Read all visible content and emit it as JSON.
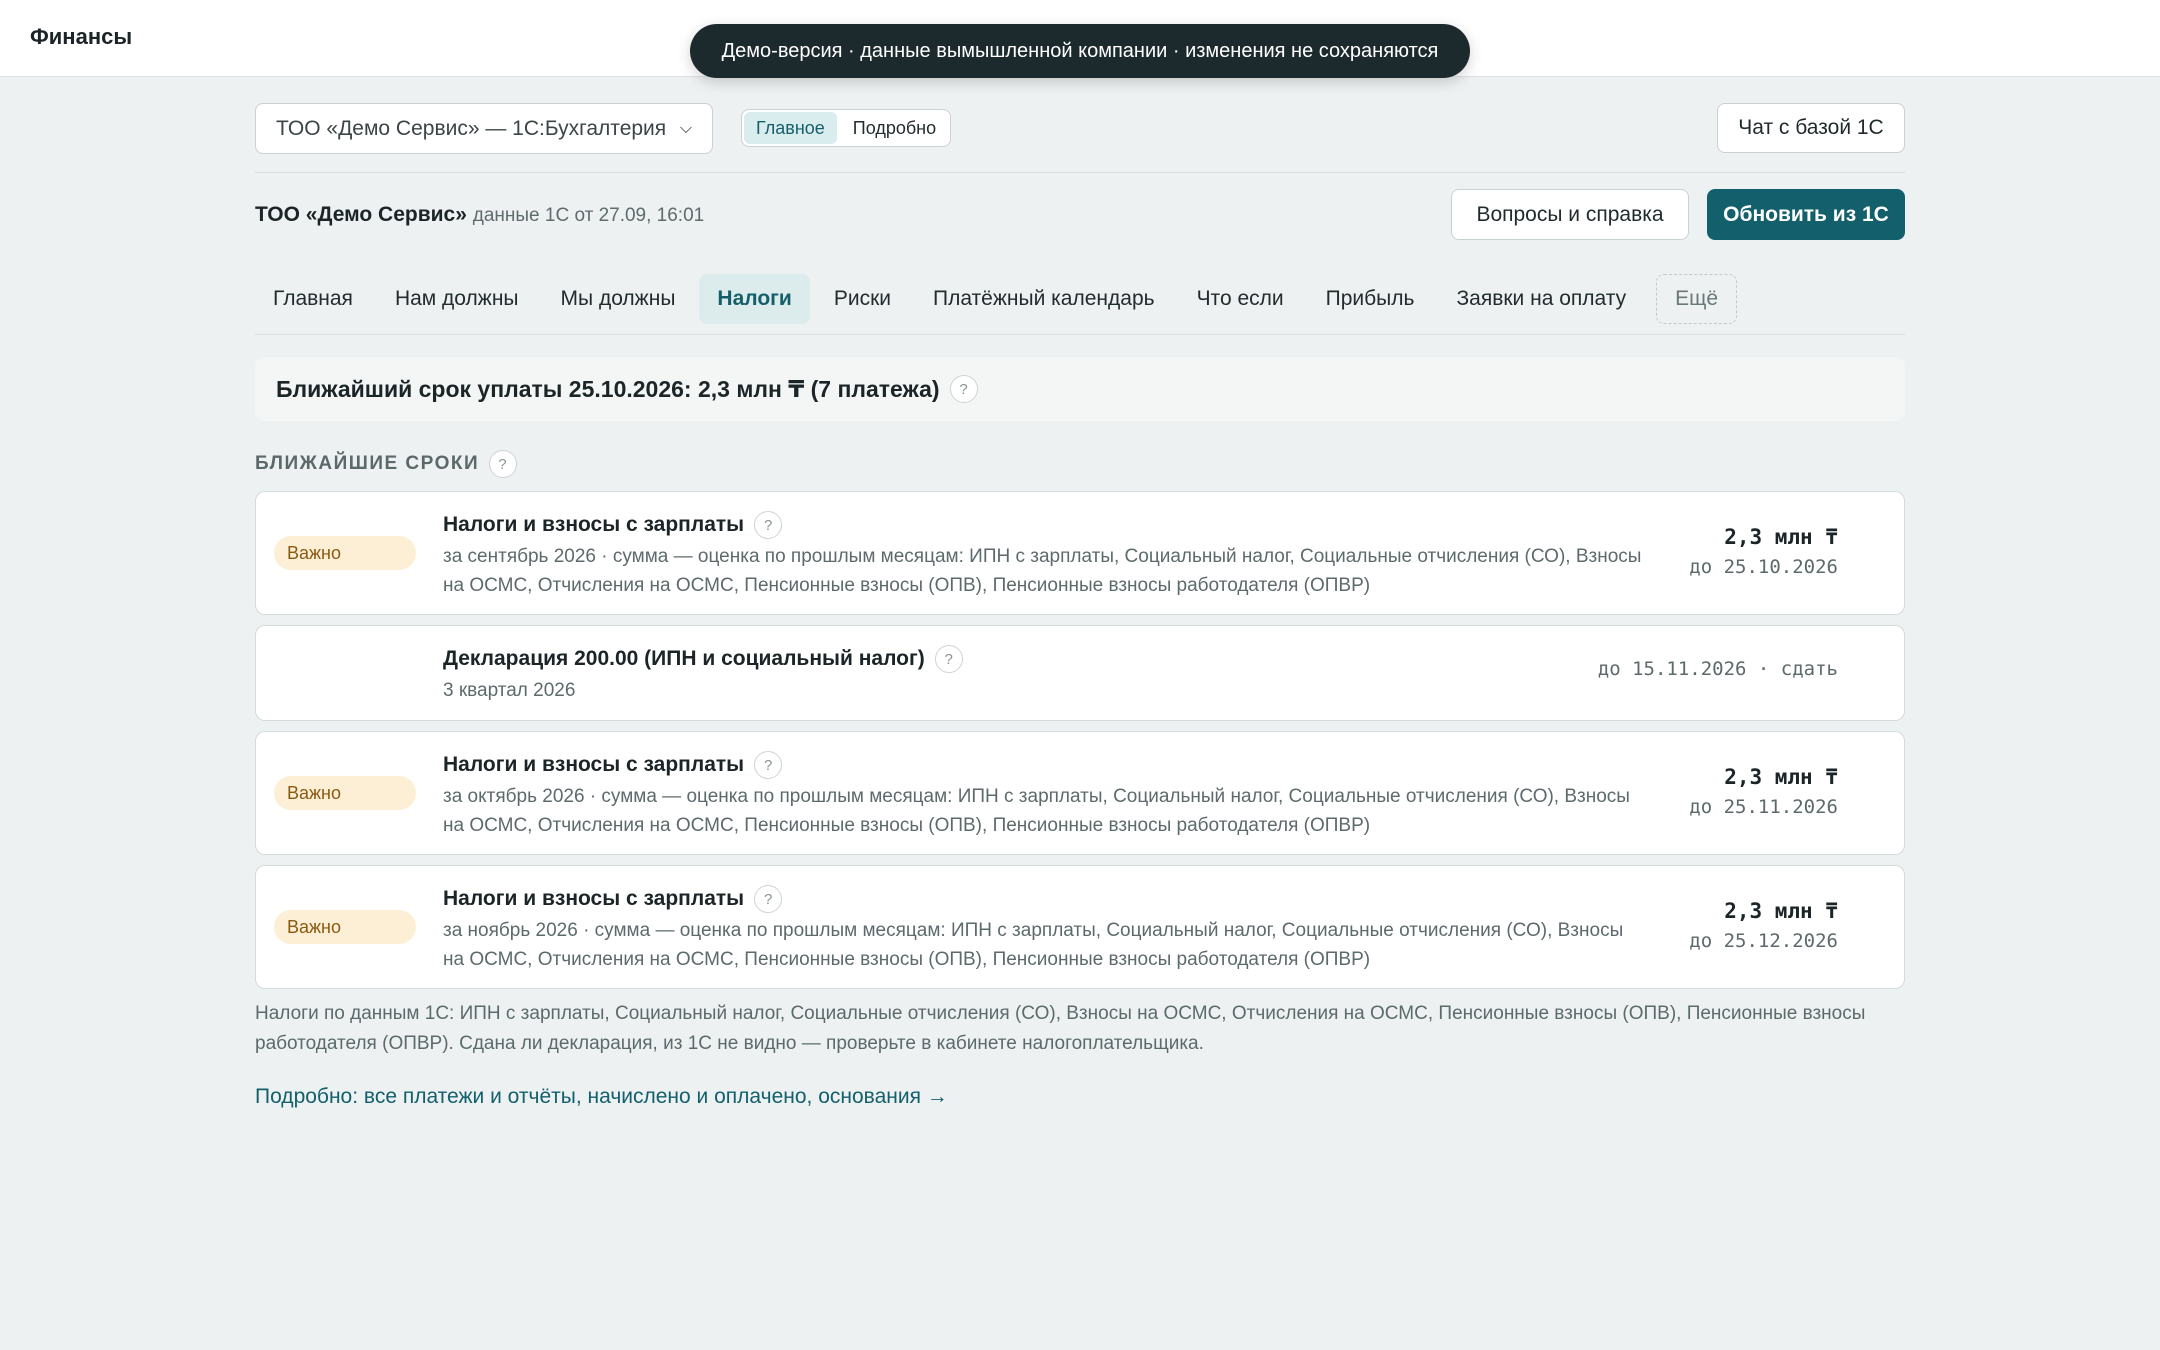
{
  "app": {
    "brand": "Финансы"
  },
  "banner": {
    "text": "Демо-версия · данные вымышленной компании · изменения не сохраняются"
  },
  "header": {
    "company_select": "ТОО «Демо Сервис» — 1С:Бухгалтерия",
    "view_modes": [
      "Главное",
      "Подробно"
    ],
    "active_view": "Главное",
    "chat_button": "Чат с базой 1С",
    "company_name": "ТОО «Демо Сервис»",
    "data_meta": "данные 1С от 27.09, 16:01",
    "help_button": "Вопросы и справка",
    "refresh_button": "Обновить из 1С"
  },
  "tabs": [
    {
      "label": "Главная",
      "active": false
    },
    {
      "label": "Нам должны",
      "active": false
    },
    {
      "label": "Мы должны",
      "active": false
    },
    {
      "label": "Налоги",
      "active": true
    },
    {
      "label": "Риски",
      "active": false
    },
    {
      "label": "Платёжный календарь",
      "active": false
    },
    {
      "label": "Что если",
      "active": false
    },
    {
      "label": "Прибыль",
      "active": false
    },
    {
      "label": "Заявки на оплату",
      "active": false
    }
  ],
  "tabs_more": "Ещё",
  "next_due": {
    "text": "Ближайший срок уплаты 25.10.2026: 2,3 млн ₸ (7 платежа)"
  },
  "help_mark": "?",
  "section": {
    "title": "БЛИЖАЙШИЕ СРОКИ"
  },
  "items": [
    {
      "badge": "Важно",
      "title": "Налоги и взносы с зарплаты",
      "subtitle": "за сентябрь 2026 · сумма — оценка по прошлым месяцам: ИПН с зарплаты, Социальный налог, Социальные отчисления (СО), Взносы на ОСМС, Отчисления на ОСМС, Пенсионные взносы (ОПВ), Пенсионные взносы работодателя (ОПВР)",
      "amount": "2,3 млн ₸",
      "due": "до 25.10.2026"
    },
    {
      "badge": "",
      "title": "Декларация 200.00 (ИПН и социальный налог)",
      "subtitle": "3 квартал 2026",
      "amount": "",
      "due": "до 15.11.2026 · сдать"
    },
    {
      "badge": "Важно",
      "title": "Налоги и взносы с зарплаты",
      "subtitle": "за октябрь 2026 · сумма — оценка по прошлым месяцам: ИПН с зарплаты, Социальный налог, Социальные отчисления (СО), Взносы на ОСМС, Отчисления на ОСМС, Пенсионные взносы (ОПВ), Пенсионные взносы работодателя (ОПВР)",
      "amount": "2,3 млн ₸",
      "due": "до 25.11.2026"
    },
    {
      "badge": "Важно",
      "title": "Налоги и взносы с зарплаты",
      "subtitle": "за ноябрь 2026 · сумма — оценка по прошлым месяцам: ИПН с зарплаты, Социальный налог, Социальные отчисления (СО), Взносы на ОСМС, Отчисления на ОСМС, Пенсионные взносы (ОПВ), Пенсионные взносы работодателя (ОПВР)",
      "amount": "2,3 млн ₸",
      "due": "до 25.12.2026"
    }
  ],
  "footnote": "Налоги по данным 1С: ИПН с зарплаты, Социальный налог, Социальные отчисления (СО), Взносы на ОСМС, Отчисления на ОСМС, Пенсионные взносы (ОПВ), Пенсионные взносы работодателя (ОПВР). Сдана ли декларация, из 1С не видно — проверьте в кабинете налогоплательщика.",
  "detail_link": "Подробно: все платежи и отчёты, начислено и оплачено, основания →",
  "colors": {
    "accent": "#13606c",
    "badge_bg": "#fcefd6",
    "badge_text": "#8a5a10",
    "background": "#edf1f1"
  }
}
